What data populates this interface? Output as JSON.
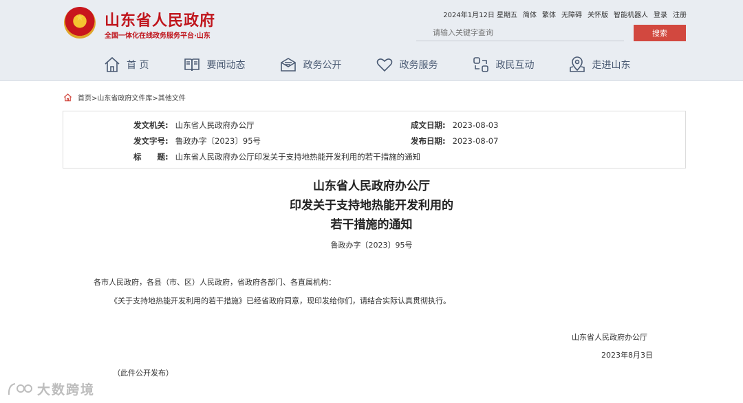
{
  "site": {
    "title": "山东省人民政府",
    "subtitle": "全国一体化在线政务服务平台·山东"
  },
  "top_links": {
    "date": "2024年1月12日 星期五",
    "simplified": "简体",
    "traditional": "繁体",
    "accessible": "无障碍",
    "elder": "关怀版",
    "robot": "智能机器人",
    "login": "登录",
    "register": "注册"
  },
  "search": {
    "placeholder": "请输入关键字查询",
    "button": "搜索"
  },
  "nav": [
    {
      "label": "首 页",
      "icon": "home-icon"
    },
    {
      "label": "要闻动态",
      "icon": "book-icon"
    },
    {
      "label": "政务公开",
      "icon": "envelope-icon"
    },
    {
      "label": "政务服务",
      "icon": "heart-icon"
    },
    {
      "label": "政民互动",
      "icon": "interact-icon"
    },
    {
      "label": "走进山东",
      "icon": "map-pin-icon"
    }
  ],
  "breadcrumb": "首页>山东省政府文件库>其他文件",
  "info": {
    "issuer_label": "发文机关:",
    "issuer": "山东省人民政府办公厅",
    "date_created_label": "成文日期:",
    "date_created": "2023-08-03",
    "doc_no_label": "发文字号:",
    "doc_no": "鲁政办字〔2023〕95号",
    "date_published_label": "发布日期:",
    "date_published": "2023-08-07",
    "title_label": "标　　题:",
    "title": "山东省人民政府办公厅印发关于支持地热能开发利用的若干措施的通知"
  },
  "document": {
    "title_line1": "山东省人民政府办公厅",
    "title_line2": "印发关于支持地热能开发利用的",
    "title_line3": "若干措施的通知",
    "doc_no": "鲁政办字〔2023〕95号",
    "salutation": "各市人民政府，各县（市、区）人民政府，省政府各部门、各直属机构：",
    "body": "《关于支持地热能开发利用的若干措施》已经省政府同意，现印发给你们，请结合实际认真贯彻执行。",
    "signature": "山东省人民政府办公厅",
    "sign_date": "2023年8月3日",
    "note": "（此件公开发布）"
  },
  "watermark": "大数跨境",
  "colors": {
    "brand_red": "#c0161d",
    "search_button": "#d2483f",
    "header_bg": "#e9edf2",
    "nav_text": "#4a5a73"
  }
}
